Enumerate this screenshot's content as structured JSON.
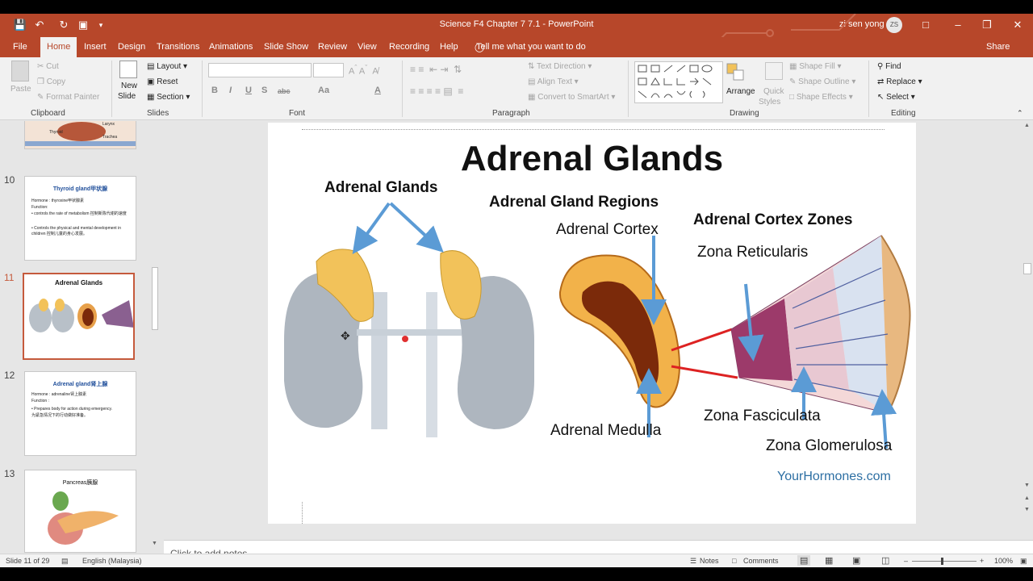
{
  "window": {
    "title": "Science F4 Chapter 7 7.1  -  PowerPoint",
    "user_name": "zi sen yong",
    "user_initials": "ZS"
  },
  "tabs": [
    "File",
    "Home",
    "Insert",
    "Design",
    "Transitions",
    "Animations",
    "Slide Show",
    "Review",
    "View",
    "Recording",
    "Help"
  ],
  "tell_me": "Tell me what you want to do",
  "share": "Share",
  "ribbon": {
    "clipboard": {
      "paste": "Paste",
      "cut": "Cut",
      "copy": "Copy",
      "format_painter": "Format Painter",
      "label": "Clipboard"
    },
    "slides": {
      "new_slide": "New",
      "new_slide2": "Slide",
      "layout": "Layout",
      "reset": "Reset",
      "section": "Section",
      "label": "Slides"
    },
    "font": {
      "bold": "B",
      "italic": "I",
      "underline": "U",
      "strike": "S",
      "spacing": "abc",
      "case": "Aa",
      "color": "A",
      "label": "Font"
    },
    "paragraph": {
      "text_direction": "Text Direction",
      "align_text": "Align Text",
      "convert_smartart": "Convert to SmartArt",
      "label": "Paragraph"
    },
    "drawing": {
      "arrange": "Arrange",
      "quick_styles": "Quick",
      "quick_styles2": "Styles",
      "shape_fill": "Shape Fill",
      "shape_outline": "Shape Outline",
      "shape_effects": "Shape Effects",
      "label": "Drawing"
    },
    "editing": {
      "find": "Find",
      "replace": "Replace",
      "select": "Select",
      "label": "Editing"
    }
  },
  "thumbnails": [
    {
      "num": "10",
      "title": "Thyroid gland甲状腺",
      "lines": [
        "Hormone : thyroxine甲状腺素",
        "Function:",
        "• controls the rate of metabolism 控制新陈代谢的速度",
        "• Controls the physical and mental development in children 控制儿童的身心发展。"
      ]
    },
    {
      "num": "11",
      "title": "Adrenal Glands"
    },
    {
      "num": "12",
      "title": "Adrenal gland肾上腺",
      "lines": [
        "Hormone : adrenaline肾上腺素",
        "Function :",
        "• Prepares body for action during emergency.",
        "  为紧急情况下的行动做好准备。"
      ]
    },
    {
      "num": "13",
      "title": "Pancreas胰腺"
    }
  ],
  "partial_thumb_labels": [
    "Thyroid",
    "Trachea",
    "Larynx"
  ],
  "slide": {
    "title": "Adrenal Glands",
    "labels": {
      "adrenal_glands": "Adrenal Glands",
      "regions": "Adrenal Gland Regions",
      "cortex_zones": "Adrenal Cortex Zones",
      "cortex": "Adrenal Cortex",
      "reticularis": "Zona Reticularis",
      "medulla": "Adrenal Medulla",
      "fasciculata": "Zona Fasciculata",
      "glomerulosa": "Zona Glomerulosa"
    },
    "watermark": "YourHormones.com"
  },
  "notes_placeholder": "Click to add notes",
  "status": {
    "slide_counter": "Slide 11 of 29",
    "language": "English (Malaysia)",
    "notes": "Notes",
    "comments": "Comments",
    "zoom": "100%"
  }
}
